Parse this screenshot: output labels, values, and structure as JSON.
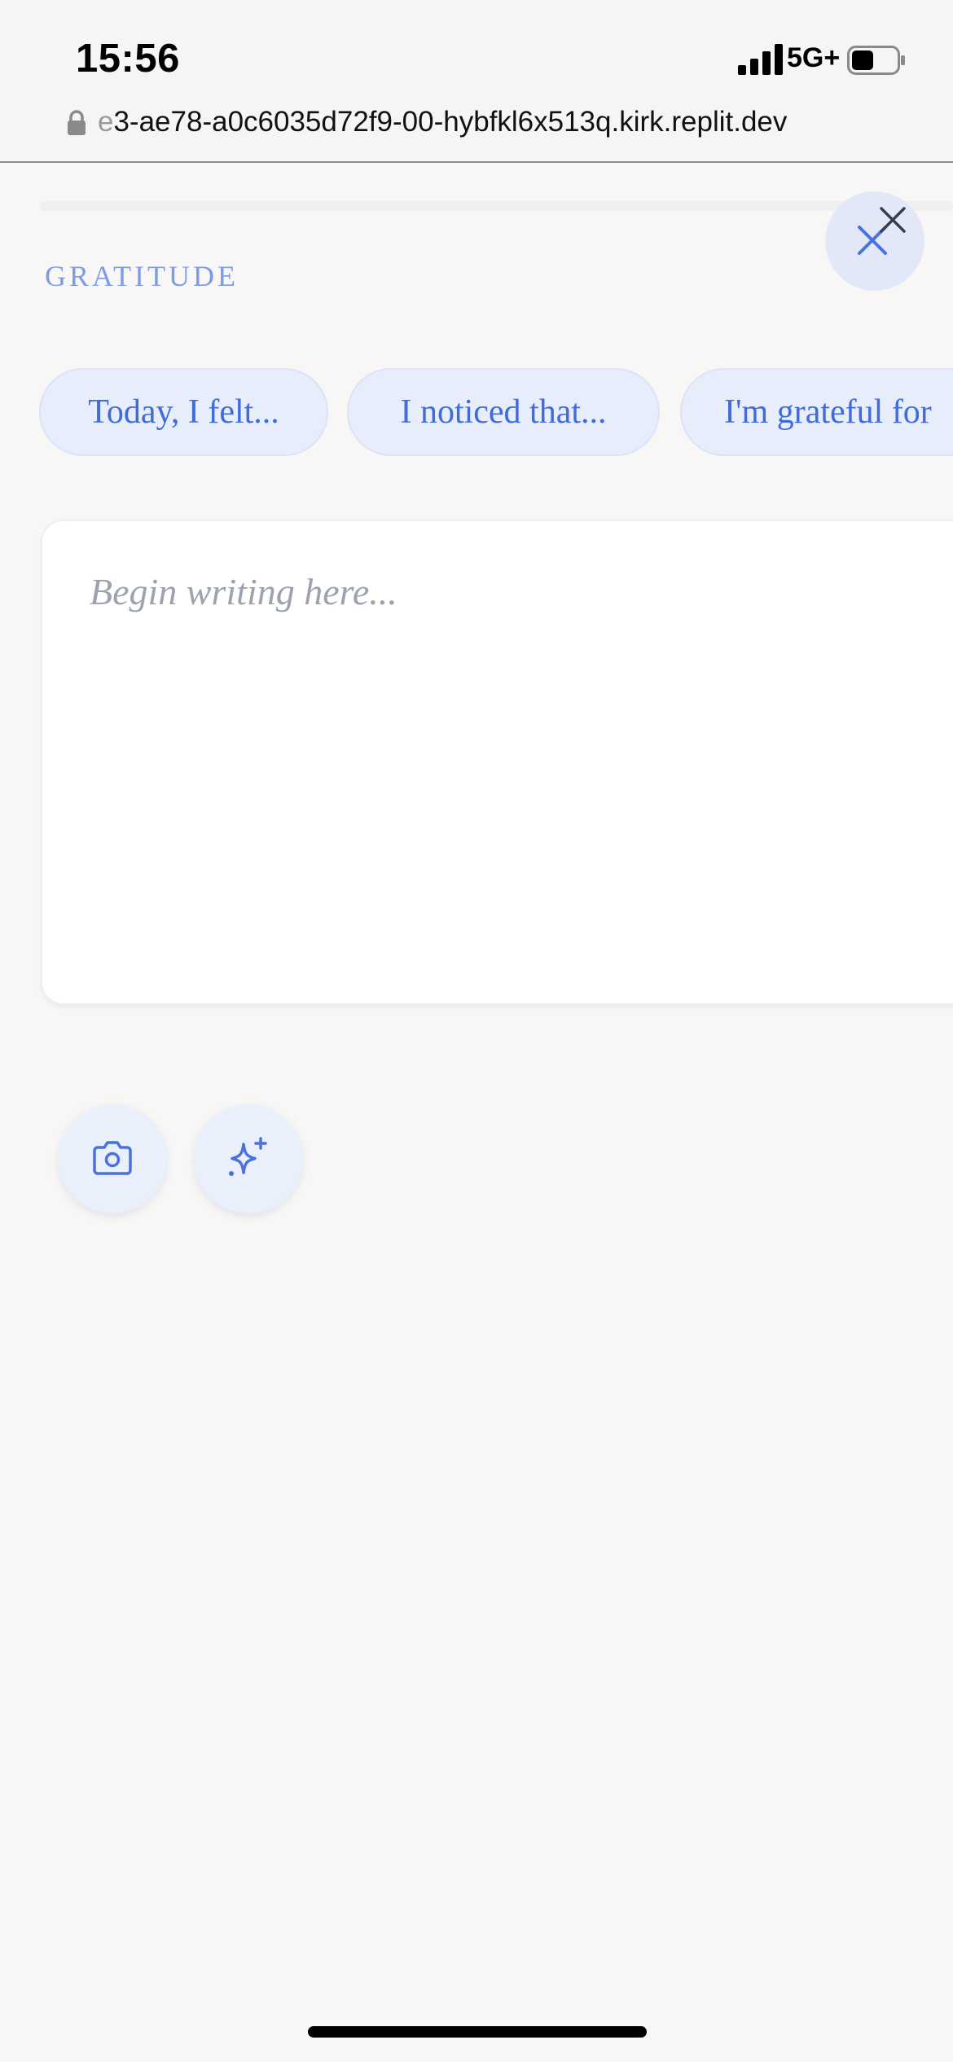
{
  "status_bar": {
    "time": "15:56",
    "network": "5G+",
    "icons": [
      "signal-icon",
      "battery-icon"
    ]
  },
  "browser": {
    "url_faded": "e",
    "url": "3-ae78-a0c6035d72f9-00-hybfkl6x513q.kirk.replit.dev",
    "lock_icon": "lock-icon"
  },
  "journal": {
    "section_label": "GRATITUDE",
    "close_icon": "close-icon",
    "prompts": [
      {
        "label": "Today, I felt..."
      },
      {
        "label": "I noticed that..."
      },
      {
        "label": "I'm grateful for"
      }
    ],
    "editor": {
      "placeholder": "Begin writing here...",
      "value": ""
    },
    "actions": [
      {
        "icon": "camera-icon"
      },
      {
        "icon": "sparkle-icon"
      }
    ]
  },
  "colors": {
    "accent": "#3f6bdc",
    "label": "#7d9be8",
    "chip_bg": "#e7edfb",
    "background": "#f8f7f5",
    "placeholder": "#9ca3af"
  }
}
